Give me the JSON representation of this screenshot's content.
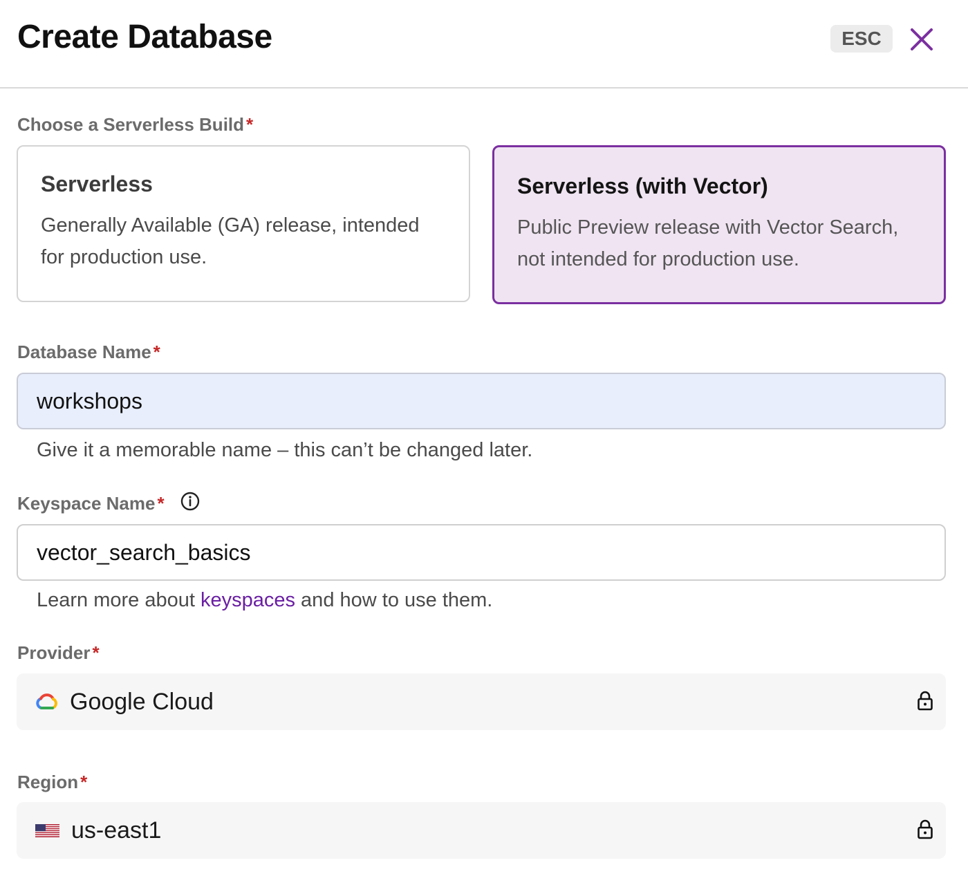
{
  "header": {
    "title": "Create Database",
    "esc_label": "ESC"
  },
  "build": {
    "label": "Choose a Serverless Build",
    "required_mark": "*",
    "options": [
      {
        "title": "Serverless",
        "description": "Generally Available (GA) release, intended for production use.",
        "selected": false
      },
      {
        "title": "Serverless (with Vector)",
        "description": "Public Preview release with Vector Search, not intended for production use.",
        "selected": true
      }
    ]
  },
  "database_name": {
    "label": "Database Name",
    "required_mark": "*",
    "value": "workshops",
    "helper": "Give it a memorable name – this can’t be changed later."
  },
  "keyspace_name": {
    "label": "Keyspace Name",
    "required_mark": "*",
    "value": "vector_search_basics",
    "helper_prefix": "Learn more about ",
    "helper_link": "keyspaces",
    "helper_suffix": " and how to use them."
  },
  "provider": {
    "label": "Provider",
    "required_mark": "*",
    "value": "Google Cloud",
    "icon": "google-cloud-icon"
  },
  "region": {
    "label": "Region",
    "required_mark": "*",
    "value": "us-east1",
    "icon": "us-flag-icon"
  },
  "colors": {
    "accent": "#7b2fa0",
    "required": "#c62828",
    "link": "#6a1fa3"
  }
}
